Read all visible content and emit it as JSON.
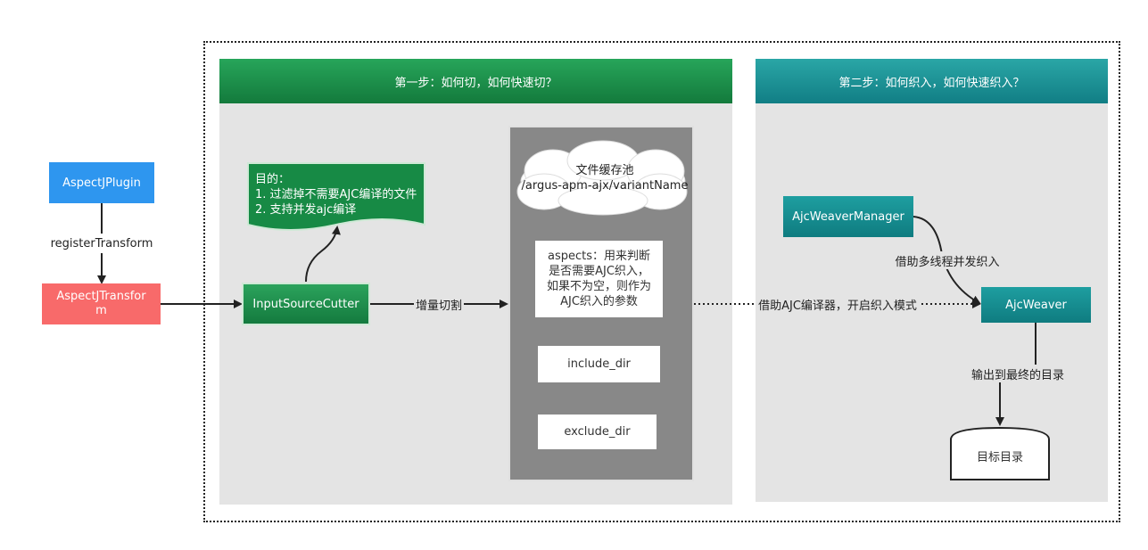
{
  "stage1": {
    "title": "第一步：如何切，如何快速切？"
  },
  "stage2": {
    "title": "第二步：如何织入，如何快速织入？"
  },
  "nodes": {
    "plugin": "AspectJPlugin",
    "transform_line1": "AspectJTransfor",
    "transform_line2": "m",
    "cutter": "InputSourceCutter",
    "manager": "AjcWeaverManager",
    "weaver": "AjcWeaver",
    "target": "目标目录"
  },
  "note": {
    "line1": "目的：",
    "line2": "1.  过滤掉不需要AJC编译的文件",
    "line3": "2. 支持并发ajc编译"
  },
  "cache": {
    "line1": "文件缓存池",
    "line2": "/argus-apm-ajx/variantName",
    "aspects_line1": "aspects：用来判断",
    "aspects_line2": "是否需要AJC织入，",
    "aspects_line3": "如果不为空，则作为",
    "aspects_line4": "AJC织入的参数",
    "include": "include_dir",
    "exclude": "exclude_dir"
  },
  "edges": {
    "register": "registerTransform",
    "slice": "增量切割",
    "ajc_compile": "借助AJC编译器，开启织入模式",
    "multithread": "借助多线程并发织入",
    "output": "输出到最终的目录"
  },
  "colors": {
    "green": "#1a8c48",
    "teal": "#17898d",
    "blue": "#2e96ef",
    "red": "#f86a6a",
    "panel": "#e4e4e4",
    "cache_bg": "#888888"
  }
}
